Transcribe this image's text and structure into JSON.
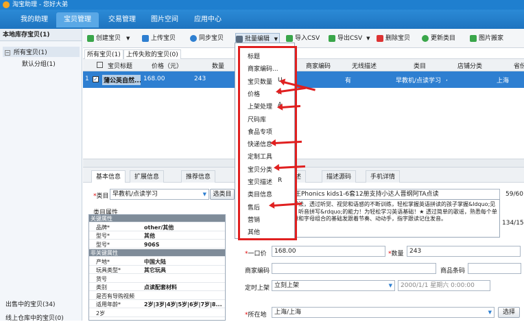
{
  "app": {
    "title": "淘宝助理 - 您好大弟"
  },
  "menu": {
    "tabs": [
      "我的助理",
      "宝贝管理",
      "交易管理",
      "图片空间",
      "应用中心"
    ],
    "active": "宝贝管理"
  },
  "sidebar": {
    "header": "本地库存宝贝(1)",
    "items": [
      "所有宝贝(1)",
      "默认分组(1)"
    ],
    "bottom": [
      "出售中的宝贝(34)",
      "线上仓库中的宝贝(0)"
    ]
  },
  "toolbar": {
    "buttons": [
      "创建宝贝",
      "上传宝贝",
      "同步宝贝",
      "批量编辑",
      "导入CSV",
      "导出CSV",
      "删除宝贝",
      "更新类目",
      "图片搬家"
    ]
  },
  "subtabs": [
    "所有宝贝(1)",
    "上传失败的宝贝(0)"
  ],
  "grid": {
    "headers": [
      "宝贝标题",
      "价格（元）",
      "数量",
      "商家编码",
      "无线描述",
      "类目",
      "店铺分类",
      "省份"
    ],
    "row": {
      "num": "1",
      "title": "蒲公英自然...",
      "price": "168.00",
      "qty": "243",
      "wireless": "有",
      "category": "早教机/点读学习",
      "shopcat": ",",
      "province": "上海"
    }
  },
  "dropdown": {
    "items": [
      {
        "label": "标题",
        "key": ""
      },
      {
        "label": "商家编码...",
        "key": ""
      },
      {
        "label": "宝贝数量",
        "key": "U"
      },
      {
        "label": "价格",
        "key": "P"
      },
      {
        "label": "上架处理",
        "key": "A"
      },
      {
        "label": "尺码库",
        "key": ""
      },
      {
        "label": "食品专项",
        "key": ""
      },
      {
        "label": "快递信息",
        "key": ""
      },
      {
        "label": "定制工具",
        "key": ""
      },
      {
        "label": "宝贝分类",
        "key": ""
      },
      {
        "label": "宝贝描述",
        "key": "R"
      },
      {
        "label": "类目信息",
        "key": ""
      },
      {
        "label": "售后",
        "key": ""
      },
      {
        "label": "营销",
        "key": ""
      },
      {
        "label": "其他",
        "key": ""
      }
    ]
  },
  "detail": {
    "tabs": [
      "基本信息",
      "扩展信息",
      "推荐信息",
      "述",
      "描述源码",
      "手机详情"
    ],
    "category_label": "类目",
    "category_value": "早教机/点读学习",
    "select_cat_btn": "选类目",
    "attr_header": "类目属性",
    "attrs": [
      {
        "k": "关键属性",
        "v": "",
        "sec": true
      },
      {
        "k": "品牌*",
        "v": "other/其他"
      },
      {
        "k": "型号*",
        "v": "其他"
      },
      {
        "k": "型号*",
        "v": "906S"
      },
      {
        "k": "非关键属性",
        "v": "",
        "sec": true
      },
      {
        "k": "产地*",
        "v": "中国大陆"
      },
      {
        "k": "玩具类型*",
        "v": "其它玩具"
      },
      {
        "k": "货号",
        "v": ""
      },
      {
        "k": "类别",
        "v": "点读配套材料"
      },
      {
        "k": "是否有导购视频",
        "v": ""
      },
      {
        "k": "适用年龄*",
        "v": "2岁|3岁|4岁|5岁|6岁|7岁|8..."
      },
      {
        "k": "2岁",
        "v": ""
      }
    ],
    "title_value": "然拼读王Phonics kids1-6套12册支持小达人晋纲阿TA点读",
    "title_count": "59/60",
    "desc_text": "百年教学法，透过听觉、视觉和语感的不断训练，轻松掌握英语拼读的孩子掌握&ldquo;见字读音，听音拼写&rdquo;的能力！为轻松学习英语基础！★ 透过简单的歌谣，熟悉每个单元的字母和字母组合的基础发跟着节奏、动动手，指字跟读记住发音。",
    "desc_count": "134/150",
    "price_label": "一口价",
    "price_value": "168.00",
    "qty_label": "数量",
    "qty_value": "243",
    "code_label": "商家编码",
    "barcode_label": "商品条码",
    "timed_label": "定时上架",
    "timed_value": "立刻上架",
    "date_value": "2000/1/1 星期六 0:00:00",
    "loc_label": "所在地",
    "loc_value": "上海/上海",
    "loc_btn": "选择"
  },
  "colors": {
    "accent": "#1f7fcf",
    "selected_row": "#2e7fd1",
    "highlight": "#e02020"
  }
}
